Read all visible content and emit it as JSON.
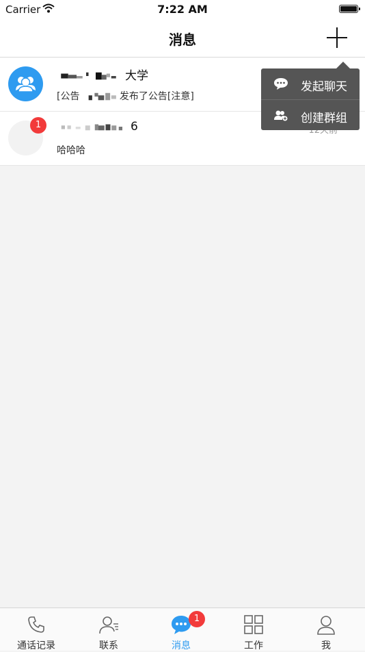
{
  "status_bar": {
    "carrier": "Carrier",
    "time": "7:22 AM"
  },
  "nav": {
    "title": "消息",
    "add_icon": "plus-icon"
  },
  "conversations": [
    {
      "name_visible": "大学",
      "preview_prefix": "[公告",
      "preview_suffix": "发布了公告[注意]",
      "avatar": "group-icon",
      "avatar_color": "#2e9bf0"
    },
    {
      "name_visible": "6",
      "preview": "哈哈哈",
      "unread": "1",
      "time": "12天前"
    }
  ],
  "popover": {
    "items": [
      {
        "label": "发起聊天",
        "icon": "chat-bubble-icon"
      },
      {
        "label": "创建群组",
        "icon": "create-group-icon"
      }
    ]
  },
  "tabs": [
    {
      "label": "通话记录",
      "icon": "phone-icon"
    },
    {
      "label": "联系",
      "icon": "contacts-icon"
    },
    {
      "label": "消息",
      "icon": "message-icon",
      "active": true,
      "badge": "1"
    },
    {
      "label": "工作",
      "icon": "grid-icon"
    },
    {
      "label": "我",
      "icon": "person-icon"
    }
  ],
  "colors": {
    "accent": "#2e9bf0",
    "badge": "#f23b3b",
    "popover_bg": "#555555"
  }
}
